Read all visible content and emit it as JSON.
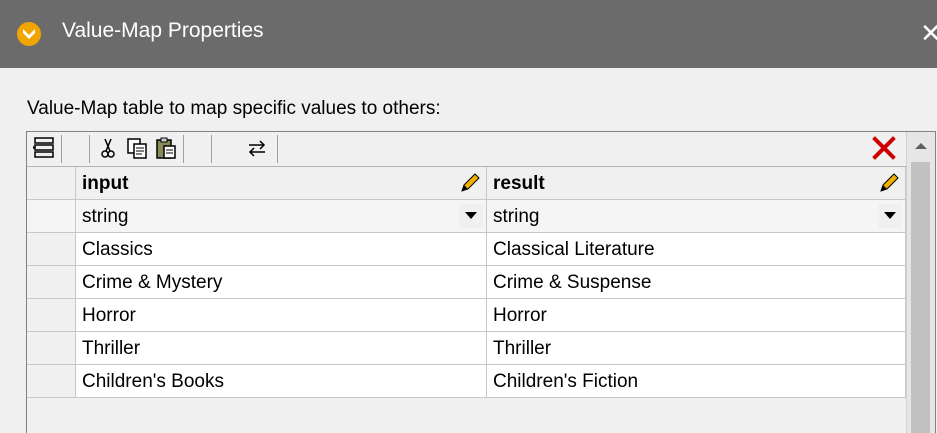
{
  "window": {
    "title": "Value-Map Properties",
    "close_glyph": "✕"
  },
  "dialog": {
    "description": "Value-Map table to map specific values to others:"
  },
  "toolbar": {
    "icons": [
      "insert-row-icon",
      "cut-icon",
      "copy-icon",
      "paste-icon",
      "swap-columns-icon",
      "delete-row-icon"
    ],
    "delete_color": "#cc0000"
  },
  "table": {
    "columns": [
      {
        "header": "input",
        "type": "string"
      },
      {
        "header": "result",
        "type": "string"
      }
    ],
    "rows": [
      {
        "input": "Classics",
        "result": "Classical Literature"
      },
      {
        "input": "Crime & Mystery",
        "result": "Crime & Suspense"
      },
      {
        "input": "Horror",
        "result": "Horror"
      },
      {
        "input": "Thriller",
        "result": "Thriller"
      },
      {
        "input": "Children's Books",
        "result": "Children's Fiction"
      }
    ]
  },
  "colors": {
    "titlebar": "#6b6b6b",
    "app_icon": "#f0a500",
    "dialog_bg": "#f0f0f0"
  }
}
